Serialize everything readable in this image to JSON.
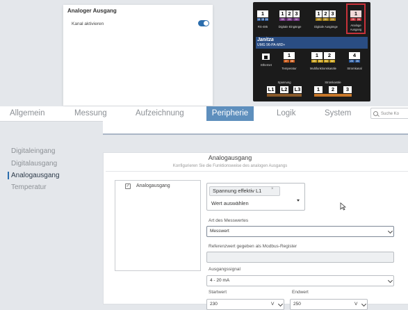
{
  "popup": {
    "title": "Analoger Ausgang",
    "label": "Kanal aktivieren",
    "enabled": true
  },
  "device": {
    "brand": "Janitza",
    "model": "UMG 96-PA-MID+",
    "blocks": {
      "rs485": "1",
      "rs485_pins": [
        "14",
        "15",
        "24"
      ],
      "rs485_caption": "RS-485",
      "din": [
        "1",
        "2",
        "3"
      ],
      "din_pins": [
        "28",
        "29",
        "30"
      ],
      "din_caption": "Digitale Eingänge",
      "dout": [
        "1",
        "2",
        "3"
      ],
      "dout_pins": [
        "19",
        "20",
        "21"
      ],
      "dout_caption": "Digitale Ausgänge",
      "aout": "1",
      "aout_pins": [
        "25",
        "26"
      ],
      "aout_caption": [
        "Analoge",
        "Ausgang"
      ],
      "eth_caption": "Ethernet",
      "temp": "1",
      "temp_pins": [
        "27",
        "28"
      ],
      "temp_caption": "Temperatur",
      "multi": [
        "1",
        "2"
      ],
      "multi_pins": [
        "29",
        "30",
        "31",
        "32"
      ],
      "multi_caption": "Multifunktionskanäle",
      "strom": "4",
      "strom_pins": [
        "25",
        "26"
      ],
      "strom_caption": "Stromkanal",
      "spannung_caption": "Spannung",
      "spannung": [
        "L1",
        "L2",
        "L3"
      ],
      "stromkanaele_caption": "Stromkanäle",
      "stromkanaele": [
        "1",
        "2",
        "3"
      ]
    }
  },
  "tabs": [
    "Allgemein",
    "Messung",
    "Aufzeichnung",
    "Peripherie",
    "Logik",
    "System"
  ],
  "active_tab": "Peripherie",
  "search": {
    "placeholder": "Suche Ko"
  },
  "sidebar": {
    "items": [
      "Digitaleingang",
      "Digitalausgang",
      "Analogausgang",
      "Temperatur"
    ],
    "active": "Analogausgang"
  },
  "card": {
    "title": "Analogausgang",
    "subtitle": "Konfigurieren Sie die Funktionsweise des analogen Ausgangs"
  },
  "list": {
    "item": "Analogausgang"
  },
  "form": {
    "chip": "Spannung effektiv L1",
    "chip_remove": "×",
    "placeholder": "Wert auswählen",
    "art_label": "Art des Messwertes",
    "art_value": "Messwert",
    "ref_label": "Referenzwert gegeben als Modbus-Register",
    "ref_value": "",
    "signal_label": "Ausgangssignal",
    "signal_value": "4 - 20 mA",
    "start_label": "Startwert",
    "start_value": "230",
    "start_unit": "V",
    "end_label": "Endwert",
    "end_value": "250",
    "end_unit": "V"
  }
}
